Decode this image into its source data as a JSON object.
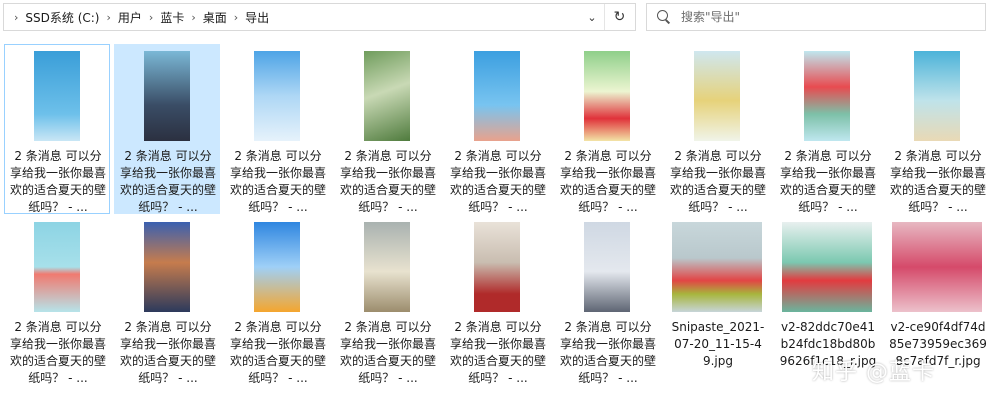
{
  "address_bar": {
    "crumbs": [
      "SSD系统 (C:)",
      "用户",
      "蓝卡",
      "桌面",
      "导出"
    ],
    "dropdown_icon": "chevron-down-icon",
    "refresh_icon": "refresh-icon"
  },
  "search": {
    "placeholder": "搜索\"导出\""
  },
  "files": [
    {
      "name": "2 条消息 可以分享给我一张你最喜欢的适合夏天的壁纸吗？ - ...",
      "thumb": "t-sky",
      "shape": "portrait",
      "state": "focused"
    },
    {
      "name": "2 条消息 可以分享给我一张你最喜欢的适合夏天的壁纸吗？ - ...",
      "thumb": "t-girl",
      "shape": "portrait",
      "state": "selected"
    },
    {
      "name": "2 条消息 可以分享给我一张你最喜欢的适合夏天的壁纸吗？ - ...",
      "thumb": "t-cloud",
      "shape": "portrait",
      "state": ""
    },
    {
      "name": "2 条消息 可以分享给我一张你最喜欢的适合夏天的壁纸吗？ - ...",
      "thumb": "t-green",
      "shape": "portrait",
      "state": ""
    },
    {
      "name": "2 条消息 可以分享给我一张你最喜欢的适合夏天的壁纸吗？ - ...",
      "thumb": "t-sea",
      "shape": "portrait",
      "state": ""
    },
    {
      "name": "2 条消息 可以分享给我一张你最喜欢的适合夏天的壁纸吗？ - ...",
      "thumb": "t-melon",
      "shape": "portrait",
      "state": ""
    },
    {
      "name": "2 条消息 可以分享给我一张你最喜欢的适合夏天的壁纸吗？ - ...",
      "thumb": "t-juice",
      "shape": "portrait",
      "state": ""
    },
    {
      "name": "2 条消息 可以分享给我一张你最喜欢的适合夏天的壁纸吗？ - ...",
      "thumb": "t-pops",
      "shape": "portrait",
      "state": ""
    },
    {
      "name": "2 条消息 可以分享给我一张你最喜欢的适合夏天的壁纸吗？ - ...",
      "thumb": "t-ice",
      "shape": "portrait",
      "state": ""
    },
    {
      "name": "2 条消息 可以分享给我一张你最喜欢的适合夏天的壁纸吗？ - ...",
      "thumb": "t-hand",
      "shape": "portrait",
      "state": ""
    },
    {
      "name": "2 条消息 可以分享给我一张你最喜欢的适合夏天的壁纸吗？ - ...",
      "thumb": "t-city",
      "shape": "portrait",
      "state": ""
    },
    {
      "name": "2 条消息 可以分享给我一张你最喜欢的适合夏天的壁纸吗？ - ...",
      "thumb": "t-orange",
      "shape": "portrait",
      "state": ""
    },
    {
      "name": "2 条消息 可以分享给我一张你最喜欢的适合夏天的壁纸吗？ - ...",
      "thumb": "t-glass",
      "shape": "portrait",
      "state": ""
    },
    {
      "name": "2 条消息 可以分享给我一张你最喜欢的适合夏天的壁纸吗？ - ...",
      "thumb": "t-stairs",
      "shape": "portrait",
      "state": ""
    },
    {
      "name": "2 条消息 可以分享给我一张你最喜欢的适合夏天的壁纸吗？ - ...",
      "thumb": "t-walk",
      "shape": "portrait",
      "state": ""
    },
    {
      "name": "Snipaste_2021-07-20_11-15-49.jpg",
      "thumb": "t-snip",
      "shape": "land",
      "state": ""
    },
    {
      "name": "v2-82ddc70e41b24fdc18bd80b9626f1c18_r.jpg",
      "thumb": "t-bowl",
      "shape": "land",
      "state": ""
    },
    {
      "name": "v2-ce90f4df74d85e73959ec3698c7afd7f_r.jpg",
      "thumb": "t-pink",
      "shape": "land",
      "state": ""
    }
  ],
  "watermark": "知乎 @蓝卡"
}
